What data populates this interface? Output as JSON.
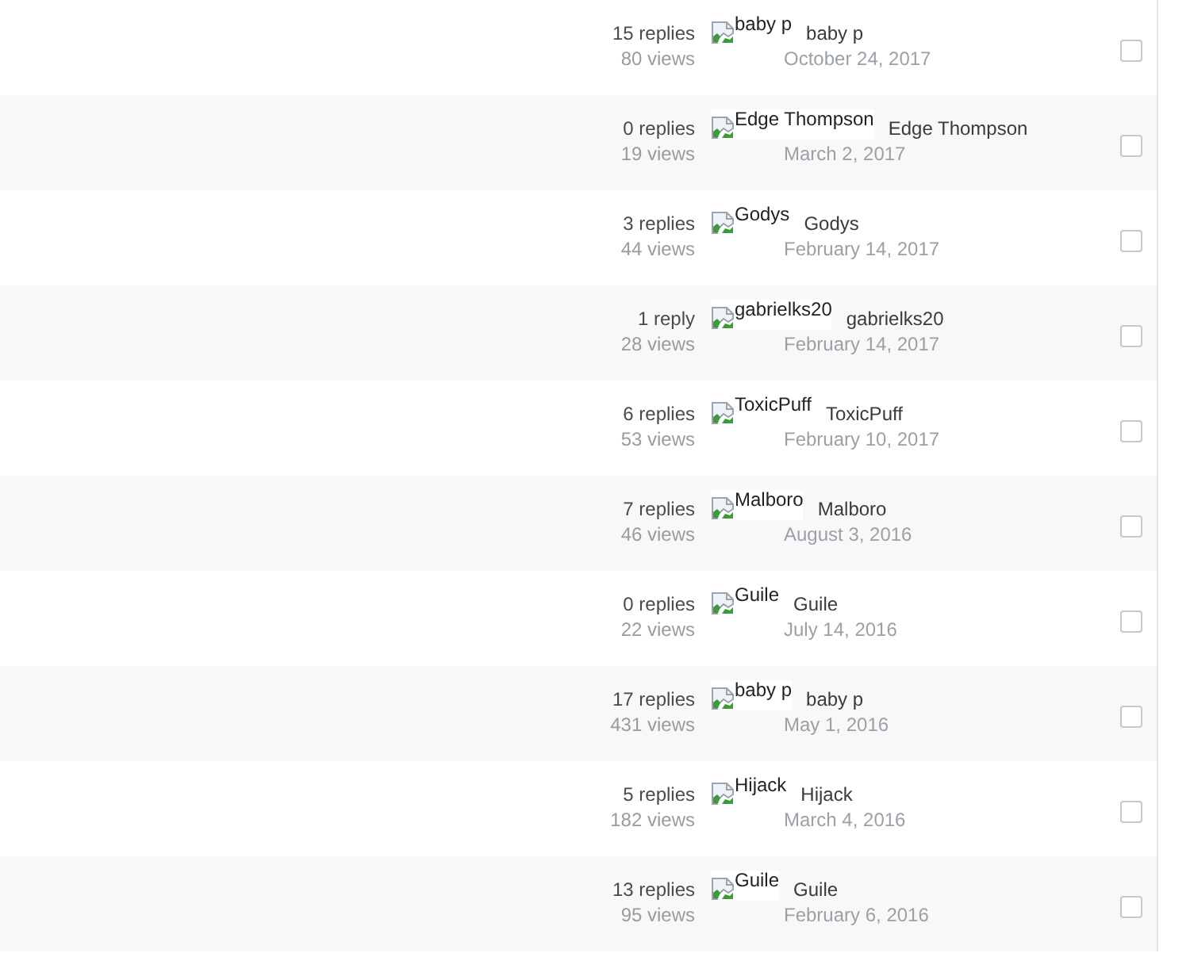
{
  "topics": [
    {
      "replies": "15 replies",
      "views": "80 views",
      "avatar_alt": "baby p",
      "author": "baby p",
      "date": "October 24, 2017",
      "checked": false
    },
    {
      "replies": "0 replies",
      "views": "19 views",
      "avatar_alt": "Edge Thompson",
      "author": "Edge Thompson",
      "date": "March 2, 2017",
      "checked": false
    },
    {
      "replies": "3 replies",
      "views": "44 views",
      "avatar_alt": "Godys",
      "author": "Godys",
      "date": "February 14, 2017",
      "checked": false
    },
    {
      "replies": "1 reply",
      "views": "28 views",
      "avatar_alt": "gabrielks20",
      "author": "gabrielks20",
      "date": "February 14, 2017",
      "checked": false
    },
    {
      "replies": "6 replies",
      "views": "53 views",
      "avatar_alt": "ToxicPuff",
      "author": "ToxicPuff",
      "date": "February 10, 2017",
      "checked": false
    },
    {
      "replies": "7 replies",
      "views": "46 views",
      "avatar_alt": "Malboro",
      "author": "Malboro",
      "date": "August 3, 2016",
      "checked": false
    },
    {
      "replies": "0 replies",
      "views": "22 views",
      "avatar_alt": "Guile",
      "author": "Guile",
      "date": "July 14, 2016",
      "checked": false
    },
    {
      "replies": "17 replies",
      "views": "431 views",
      "avatar_alt": "baby p",
      "author": "baby p",
      "date": "May 1, 2016",
      "checked": false
    },
    {
      "replies": "5 replies",
      "views": "182 views",
      "avatar_alt": "Hijack",
      "author": "Hijack",
      "date": "March 4, 2016",
      "checked": false
    },
    {
      "replies": "13 replies",
      "views": "95 views",
      "avatar_alt": "Guile",
      "author": "Guile",
      "date": "February 6, 2016",
      "checked": false
    }
  ]
}
